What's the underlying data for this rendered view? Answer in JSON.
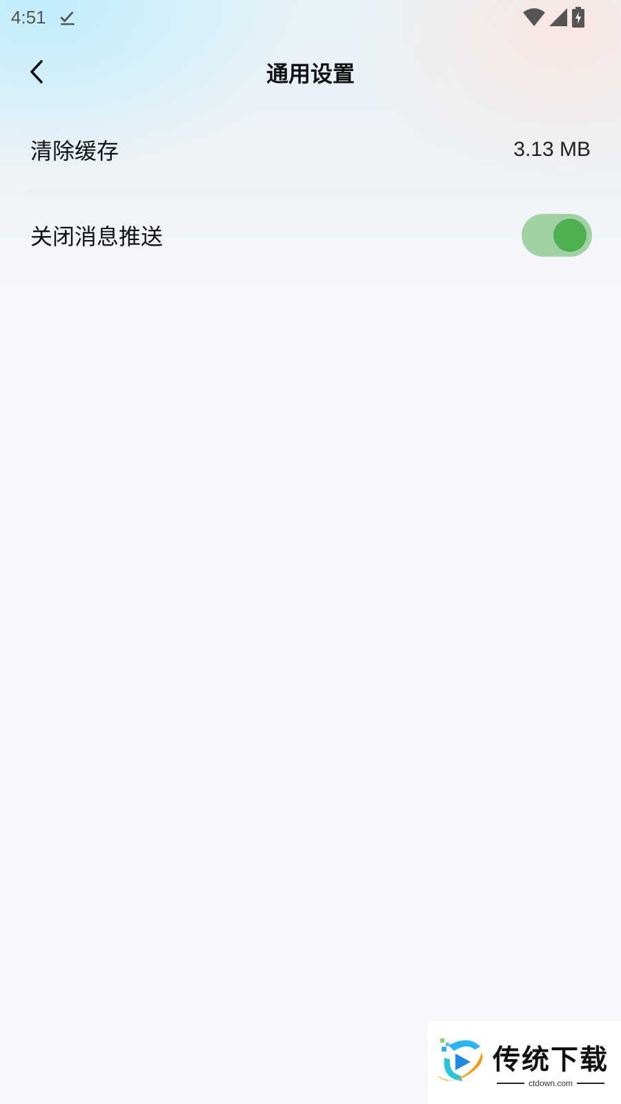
{
  "status_bar": {
    "time": "4:51"
  },
  "header": {
    "title": "通用设置"
  },
  "settings": {
    "clear_cache": {
      "label": "清除缓存",
      "value": "3.13 MB"
    },
    "push_notifications": {
      "label": "关闭消息推送",
      "enabled": true
    }
  },
  "watermark": {
    "title": "传统下载",
    "subtitle": "ctdown.com"
  },
  "colors": {
    "toggle_track": "#9fd1a2",
    "toggle_knob": "#4caf50"
  },
  "icons": [
    "download-done-icon",
    "wifi-icon",
    "signal-icon",
    "battery-charging-icon",
    "back-chevron-icon"
  ]
}
